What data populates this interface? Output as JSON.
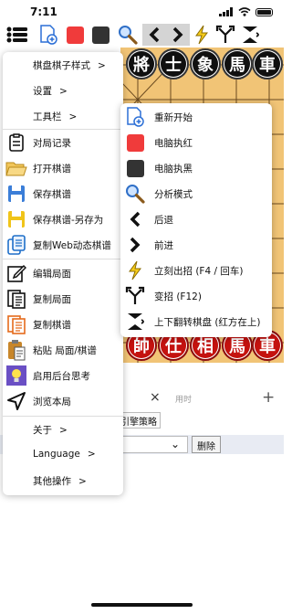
{
  "status_bar": {
    "time": "7:11"
  },
  "toolbar": {
    "items": [
      "menu-icon",
      "new-game-icon",
      "red-square-icon",
      "black-square-icon",
      "search-icon",
      "chevron-left-icon",
      "chevron-right-icon",
      "lightning-icon",
      "branch-icon",
      "flip-icon"
    ]
  },
  "board": {
    "top_row": [
      "將",
      "士",
      "象",
      "馬",
      "車"
    ],
    "bottom_row": [
      "帥",
      "仕",
      "相",
      "馬",
      "車"
    ],
    "colors": {
      "board": "#f1c476",
      "red_piece": "#c4120f",
      "black_piece": "#101010"
    }
  },
  "panel": {
    "close": "×",
    "time_label": "用时",
    "add": "+",
    "engine_strategy": "引擎策略",
    "delete_button": "删除"
  },
  "main_menu": {
    "items": [
      {
        "label": "棋盘棋子样式",
        "arrow": ">"
      },
      {
        "label": "设置",
        "arrow": ">"
      },
      {
        "label": "工具栏",
        "arrow": ">"
      },
      {
        "label": "对局记录",
        "icon": "record-icon"
      },
      {
        "label": "打开棋谱",
        "icon": "folder-icon"
      },
      {
        "label": "保存棋谱",
        "icon": "save-icon"
      },
      {
        "label": "保存棋谱-另存为",
        "icon": "save-as-icon"
      },
      {
        "label": "复制Web动态棋谱",
        "icon": "copy-web-icon"
      },
      {
        "label": "编辑局面",
        "icon": "edit-icon"
      },
      {
        "label": "复制局面",
        "icon": "copy-position-icon"
      },
      {
        "label": "复制棋谱",
        "icon": "copy-record-icon"
      },
      {
        "label": "粘贴 局面/棋谱",
        "icon": "paste-icon"
      },
      {
        "label": "启用后台思考",
        "icon": "bulb-icon"
      },
      {
        "label": "浏览本局",
        "icon": "navigate-icon"
      },
      {
        "label": "关于",
        "arrow": ">"
      },
      {
        "label": "Language",
        "arrow": ">"
      },
      {
        "label": "其他操作",
        "arrow": ">"
      }
    ]
  },
  "submenu": {
    "items": [
      {
        "label": "重新开始",
        "icon": "new-game-icon"
      },
      {
        "label": "电脑执红",
        "icon": "red-square-icon"
      },
      {
        "label": "电脑执黑",
        "icon": "black-square-icon"
      },
      {
        "label": "分析模式",
        "icon": "search-icon"
      },
      {
        "label": "后退",
        "icon": "chevron-left-icon"
      },
      {
        "label": "前进",
        "icon": "chevron-right-icon"
      },
      {
        "label": "立刻出招 (F4 / 回车)",
        "icon": "lightning-icon"
      },
      {
        "label": "变招 (F12)",
        "icon": "branch-icon"
      },
      {
        "label": "上下翻转棋盘 (红方在上)",
        "icon": "flip-icon"
      }
    ]
  }
}
